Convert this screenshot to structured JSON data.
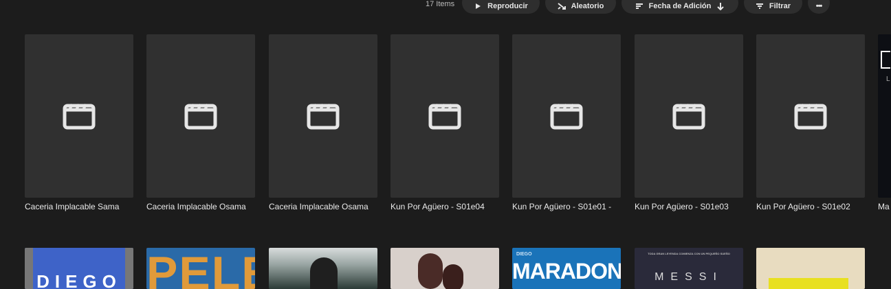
{
  "toolbar": {
    "count": "17 Items",
    "play_label": "Reproducir",
    "shuffle_label": "Aleatorio",
    "sort_label": "Fecha de Adición",
    "filter_label": "Filtrar",
    "more_label": "•••"
  },
  "items": [
    {
      "title": "Caceria Implacable Sama"
    },
    {
      "title": "Caceria Implacable Osama"
    },
    {
      "title": "Caceria Implacable Osama"
    },
    {
      "title": "Kun Por Agüero - S01e04"
    },
    {
      "title": "Kun Por Agüero - S01e01 -"
    },
    {
      "title": "Kun Por Agüero - S01e03"
    },
    {
      "title": "Kun Por Agüero - S01e02"
    },
    {
      "title": "Ma"
    }
  ],
  "row2": [
    {
      "poster_text": "DIEGO",
      "color": "#3e63c8"
    },
    {
      "poster_text": "PELE",
      "color": "#2a6aa8"
    },
    {
      "poster_text": "",
      "color": "#2b3a36"
    },
    {
      "poster_text": "",
      "color": "#d8d0cb"
    },
    {
      "poster_text_small": "DIEGO",
      "poster_text": "MARADONA",
      "color": "#1a73b9"
    },
    {
      "poster_text_small": "TODA GRAN LEYENDA COMIENZA CON UN PEQUEÑO SUEÑO",
      "poster_text": "MESSI",
      "color": "#2a2a3a"
    },
    {
      "poster_text": "",
      "color": "#e8dcc0"
    }
  ]
}
